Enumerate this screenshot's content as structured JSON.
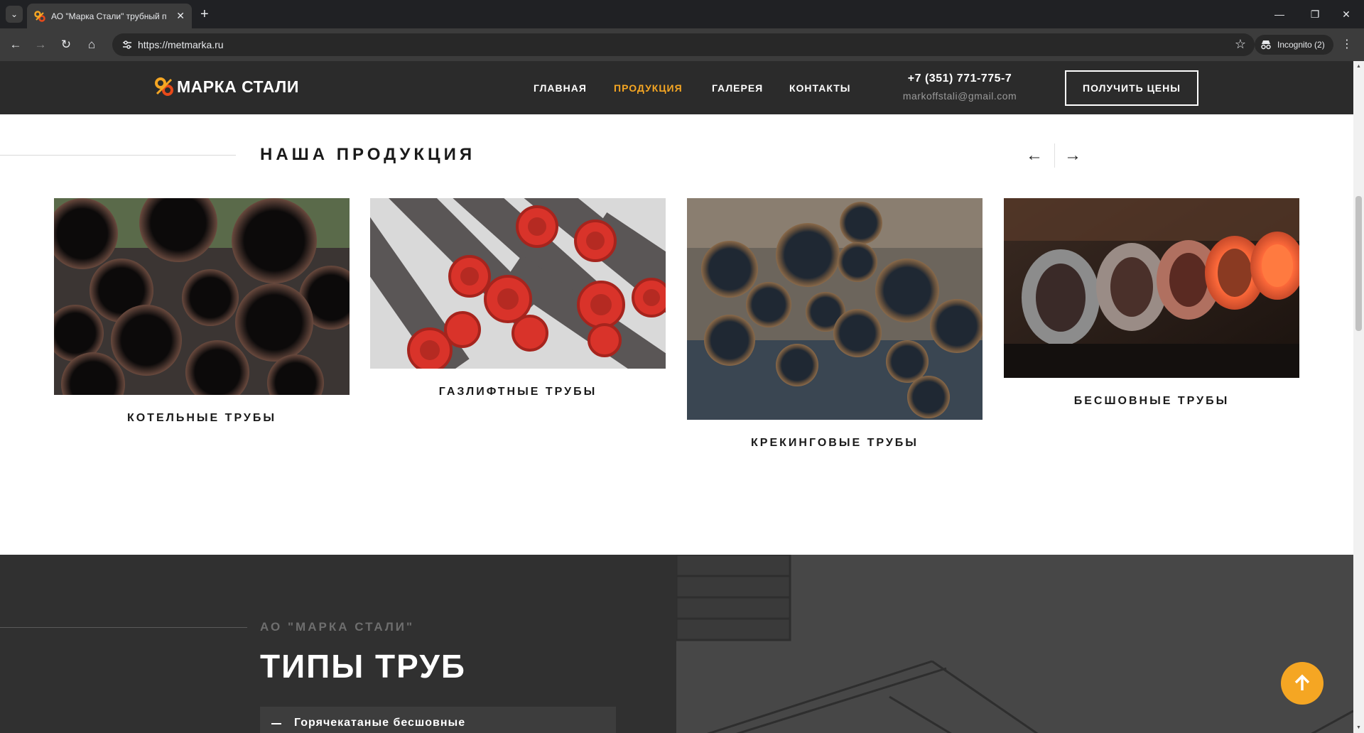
{
  "browser": {
    "tab_title": "АО \"Марка Стали\" трубный п",
    "url": "https://metmarka.ru",
    "incognito_label": "Incognito (2)"
  },
  "header": {
    "logo_text": "МАРКА СТАЛИ",
    "nav": [
      {
        "label": "ГЛАВНАЯ",
        "active": false
      },
      {
        "label": "ПРОДУКЦИЯ",
        "active": true
      },
      {
        "label": "ГАЛЕРЕЯ",
        "active": false
      },
      {
        "label": "КОНТАКТЫ",
        "active": false
      }
    ],
    "phone": "+7 (351) 771-775-7",
    "email": "markoffstali@gmail.com",
    "cta_label": "ПОЛУЧИТЬ ЦЕНЫ"
  },
  "products": {
    "title": "НАША ПРОДУКЦИЯ",
    "items": [
      {
        "label": "КОТЕЛЬНЫЕ ТРУБЫ"
      },
      {
        "label": "ГАЗЛИФТНЫЕ ТРУБЫ"
      },
      {
        "label": "КРЕКИНГОВЫЕ ТРУБЫ"
      },
      {
        "label": "БЕСШОВНЫЕ ТРУБЫ"
      }
    ]
  },
  "types_section": {
    "eyebrow": "АО \"МАРКА СТАЛИ\"",
    "title": "ТИПЫ ТРУБ",
    "accordion_first": "Горячекатаные бесшовные"
  },
  "colors": {
    "accent": "#f5a623",
    "header_bg": "#2b2b2b",
    "dark_section_bg": "#303030"
  },
  "icons": {
    "back": "arrow-left-icon",
    "forward": "arrow-right-icon",
    "scroll_top": "arrow-up-icon"
  }
}
